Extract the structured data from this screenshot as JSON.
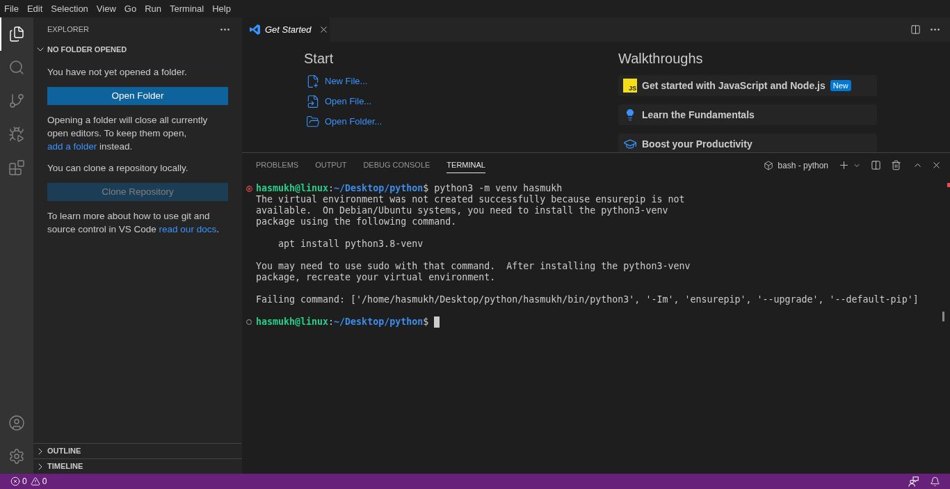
{
  "menu_bar": {
    "items": [
      "File",
      "Edit",
      "Selection",
      "View",
      "Go",
      "Run",
      "Terminal",
      "Help"
    ]
  },
  "activity_bar": {
    "items": [
      {
        "selected": true
      },
      {
        "selected": false
      },
      {
        "selected": false
      },
      {
        "selected": false
      },
      {
        "selected": false
      }
    ]
  },
  "sidebar": {
    "title": "EXPLORER",
    "sections": [
      {
        "title": "NO FOLDER OPENED",
        "expanded": true,
        "content": [
          {
            "kind": "text",
            "text": "You have not yet opened a folder."
          },
          {
            "kind": "button",
            "label": "Open Folder",
            "disabled": false
          },
          {
            "kind": "text",
            "text": "Opening a folder will close all currently open editors. To keep them open, ",
            "link": "add a folder",
            "after": " instead."
          },
          {
            "kind": "text",
            "text": "You can clone a repository locally."
          },
          {
            "kind": "button",
            "label": "Clone Repository",
            "disabled": true
          },
          {
            "kind": "text",
            "text": "To learn more about how to use git and source control in VS Code ",
            "link": "read our docs",
            "after": "."
          }
        ]
      },
      {
        "title": "OUTLINE",
        "expanded": false
      },
      {
        "title": "TIMELINE",
        "expanded": false
      }
    ]
  },
  "editor": {
    "tabs": [
      {
        "label": "Get Started",
        "selected": true,
        "preview": true
      }
    ],
    "get_started": {
      "start": {
        "title": "Start",
        "items": [
          {
            "kind": "create",
            "label": "New File..."
          },
          {
            "kind": "file",
            "label": "Open File..."
          },
          {
            "kind": "folder",
            "label": "Open Folder..."
          }
        ]
      },
      "walkthroughs": {
        "title": "Walkthroughs",
        "items": [
          {
            "kind": "js",
            "logo": "JS",
            "label": "Get started with JavaScript and Node.js",
            "badge": "New"
          },
          {
            "kind": "bulb",
            "label": "Learn the Fundamentals"
          },
          {
            "kind": "cap",
            "label": "Boost your Productivity"
          }
        ]
      }
    }
  },
  "panel": {
    "tabs": [
      {
        "label": "PROBLEMS",
        "selected": false
      },
      {
        "label": "OUTPUT",
        "selected": false
      },
      {
        "label": "DEBUG CONSOLE",
        "selected": false
      },
      {
        "label": "TERMINAL",
        "selected": true
      }
    ],
    "terminal": {
      "name": "bash - python",
      "lines": [
        {
          "kind": "prompt",
          "error": true,
          "user": "hasmukh@linux",
          "separator": ":",
          "path": "~/Desktop/python",
          "symbol": "$",
          "command": "python3 -m venv hasmukh",
          "cursor": false
        },
        {
          "kind": "output",
          "text": "The virtual environment was not created successfully because ensurepip is not"
        },
        {
          "kind": "output",
          "text": "available.  On Debian/Ubuntu systems, you need to install the python3-venv"
        },
        {
          "kind": "output",
          "text": "package using the following command."
        },
        {
          "kind": "blank"
        },
        {
          "kind": "output",
          "text": "    apt install python3.8-venv"
        },
        {
          "kind": "blank"
        },
        {
          "kind": "output",
          "text": "You may need to use sudo with that command.  After installing the python3-venv"
        },
        {
          "kind": "output",
          "text": "package, recreate your virtual environment."
        },
        {
          "kind": "blank"
        },
        {
          "kind": "output",
          "text": "Failing command: ['/home/hasmukh/Desktop/python/hasmukh/bin/python3', '-Im', 'ensurepip', '--upgrade', '--default-pip']"
        },
        {
          "kind": "blank"
        },
        {
          "kind": "prompt",
          "error": false,
          "user": "hasmukh@linux",
          "separator": ":",
          "path": "~/Desktop/python",
          "symbol": "$",
          "cursor": true
        }
      ]
    }
  },
  "status_bar": {
    "errors": "0",
    "warnings": "0"
  }
}
